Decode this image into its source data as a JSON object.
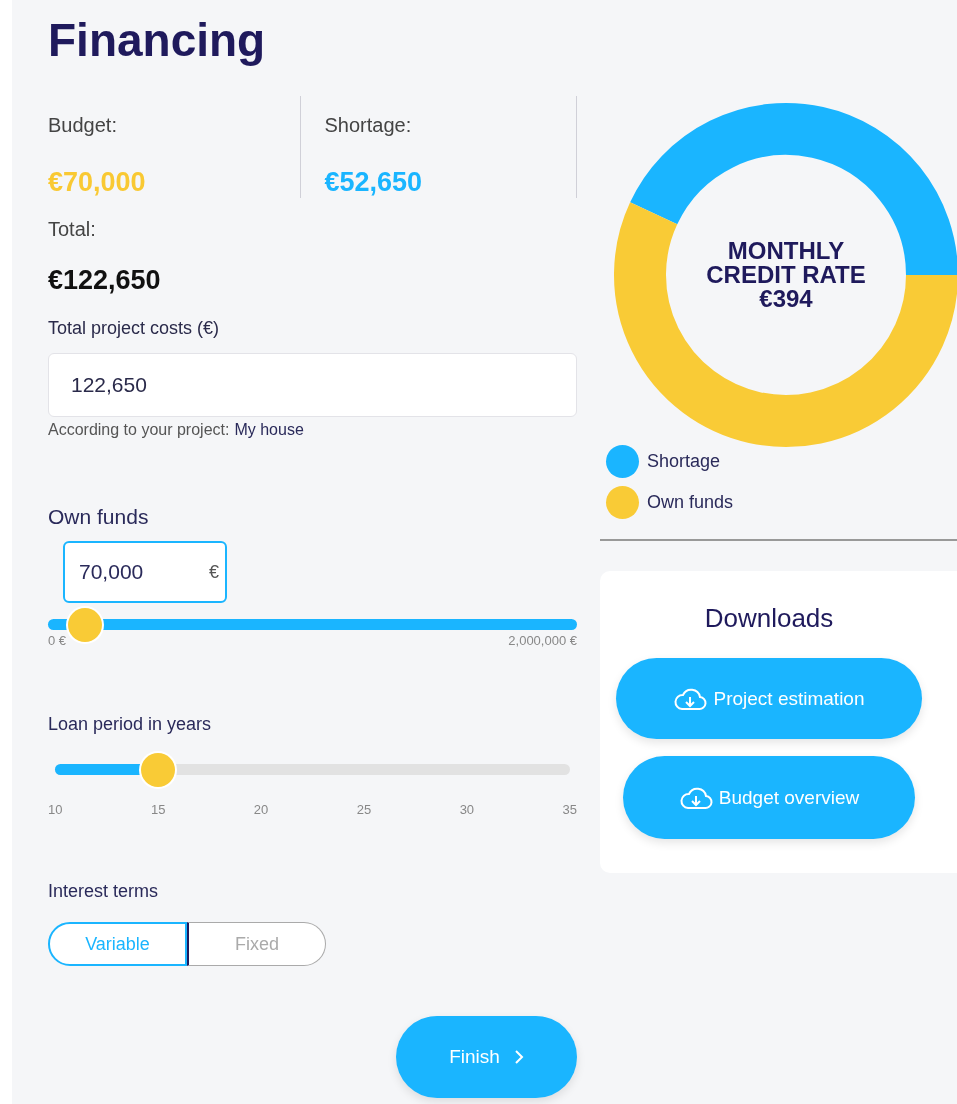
{
  "title": "Financing",
  "summary": [
    {
      "label": "Budget:",
      "value": "€70,000",
      "kind": "budget"
    },
    {
      "label": "Shortage:",
      "value": "€52,650",
      "kind": "shortage"
    }
  ],
  "total": {
    "label": "Total:",
    "value": "€122,650"
  },
  "project_costs": {
    "label": "Total project costs (€)",
    "value": "122,650",
    "hint": "According to your project:",
    "project": "My house"
  },
  "own_funds": {
    "label": "Own funds",
    "value": "70,000",
    "unit": "€",
    "level": 0.07,
    "min": "0 €",
    "max": "2,000,000 €"
  },
  "loan_period": {
    "label": "Loan period in years",
    "level": 0.2,
    "ticks": [
      "10",
      "15",
      "20",
      "25",
      "30",
      "35"
    ]
  },
  "interest_terms": {
    "label": "Interest terms",
    "options": [
      {
        "label": "Variable",
        "selected": true
      },
      {
        "label": "Fixed",
        "selected": false
      }
    ]
  },
  "finish_button": "Finish",
  "chart": {
    "center_lines": [
      "MONTHLY",
      "CREDIT RATE",
      "€394"
    ],
    "legend": [
      {
        "label": "Shortage",
        "color": "#1ab5ff"
      },
      {
        "label": "Own funds",
        "color": "#f9cb36"
      }
    ]
  },
  "downloads": {
    "title": "Downloads",
    "buttons": [
      "Project estimation",
      "Budget overview"
    ]
  }
}
